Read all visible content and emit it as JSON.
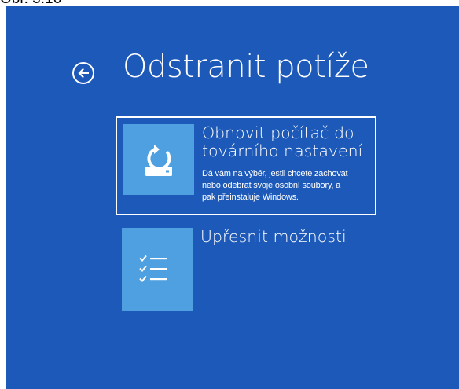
{
  "caption": "Obr. 5.16",
  "page": {
    "title": "Odstranit potíže"
  },
  "options": [
    {
      "title_lines": [
        "Obnovit počítač do",
        "továrního nastavení"
      ],
      "description_lines": [
        "Dá vám na výběr, jestli chcete zachovat",
        "nebo odebrat svoje osobní soubory, a",
        "pak přeinstaluje Windows."
      ],
      "icon": "reset-drive-icon",
      "selected": true
    },
    {
      "title": "Upřesnit možnosti",
      "icon": "checklist-icon",
      "selected": false
    }
  ],
  "colors": {
    "background": "#1d59b8",
    "tile": "#4ea0e0",
    "text": "#ffffff"
  }
}
